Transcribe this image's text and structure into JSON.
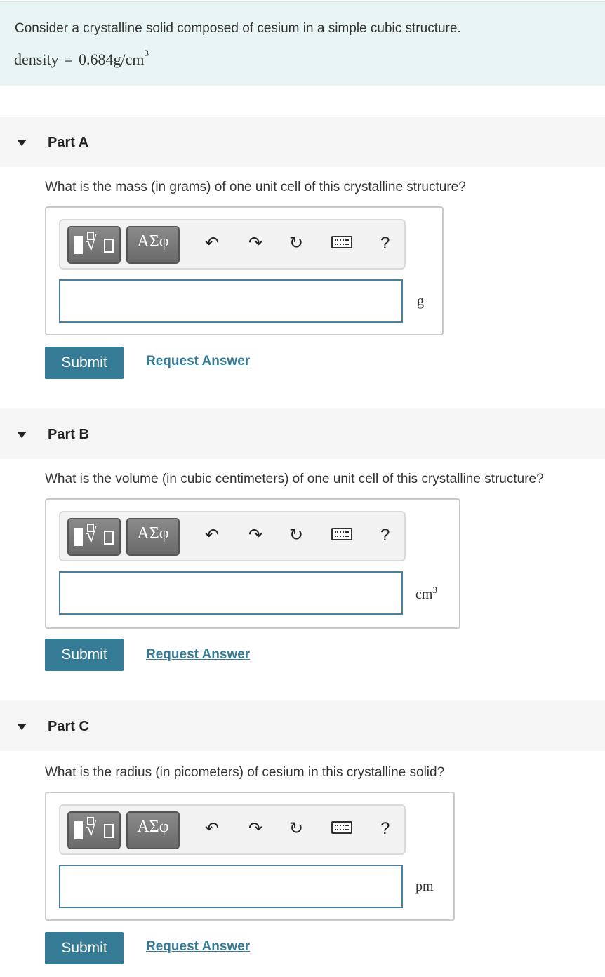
{
  "intro": {
    "text": "Consider a crystalline solid composed of cesium in a simple cubic structure.",
    "formula_lhs": "density",
    "formula_op": "=",
    "formula_rhs": "0.684g/cm",
    "formula_sup": "3"
  },
  "toolbar": {
    "greek_label": "ΑΣφ",
    "undo_icon": "undo-icon",
    "redo_icon": "redo-icon",
    "reset_icon": "reset-icon",
    "keyboard_icon": "keyboard-icon",
    "help_label": "?"
  },
  "parts": [
    {
      "title": "Part A",
      "question": "What is the mass (in grams) of one unit cell of this crystalline structure?",
      "unit": "g",
      "unit_sup": "",
      "input_value": "",
      "submit_label": "Submit",
      "request_label": "Request Answer"
    },
    {
      "title": "Part B",
      "question": "What is the volume (in cubic centimeters) of one unit cell of this crystalline structure?",
      "unit": "cm",
      "unit_sup": "3",
      "input_value": "",
      "submit_label": "Submit",
      "request_label": "Request Answer"
    },
    {
      "title": "Part C",
      "question": "What is the radius (in picometers) of cesium in this crystalline solid?",
      "unit": "pm",
      "unit_sup": "",
      "input_value": "",
      "submit_label": "Submit",
      "request_label": "Request Answer"
    }
  ],
  "colors": {
    "intro_bg": "#e9f5f5",
    "header_bg": "#f5f5f5",
    "accent": "#367b96",
    "input_border": "#4a7fa0"
  }
}
